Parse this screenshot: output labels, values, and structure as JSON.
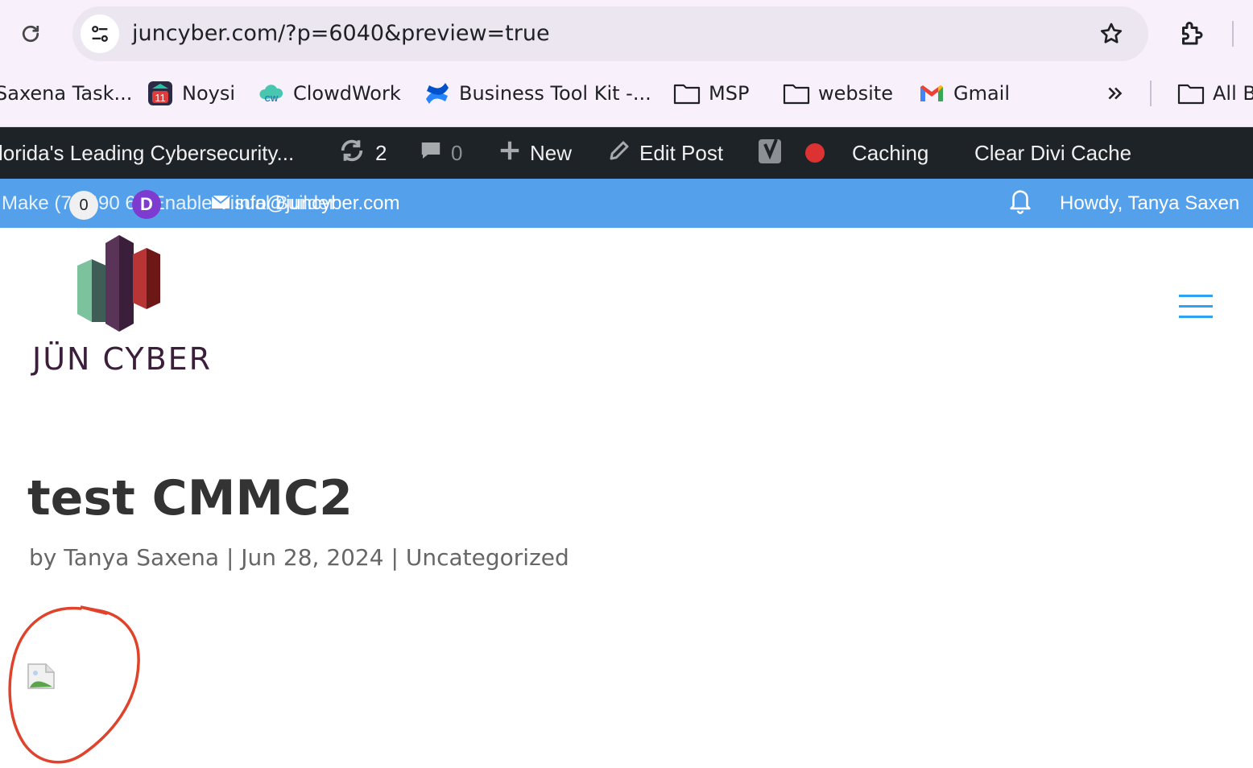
{
  "browser": {
    "url": "juncyber.com/?p=6040&preview=true",
    "bookmarks": [
      {
        "label": "Saxena Task...",
        "icon": "none"
      },
      {
        "label": "Noysi",
        "icon": "noysi-icon"
      },
      {
        "label": "ClowdWork",
        "icon": "clowdwork-icon"
      },
      {
        "label": "Business Tool Kit -...",
        "icon": "confluence-icon"
      },
      {
        "label": "MSP",
        "icon": "folder-icon"
      },
      {
        "label": "website",
        "icon": "folder-icon"
      },
      {
        "label": "Gmail",
        "icon": "gmail-icon"
      }
    ],
    "all_bookmarks_label": "All B",
    "noysi_badge": "11"
  },
  "admin_bar": {
    "site_name": "lorida's Leading Cybersecurity...",
    "updates_count": "2",
    "comments_count": "0",
    "new_label": "New",
    "edit_post_label": "Edit Post",
    "caching_label": "Caching",
    "clear_cache_label": "Clear Divi Cache"
  },
  "top_bar": {
    "overlap_text": "Make (71 490 66 Enable Visual Builder",
    "notif_count": "0",
    "email": "info@juncyber.com",
    "howdy": "Howdy, Tanya Saxen"
  },
  "header": {
    "logo_text": "JÜN CYBER"
  },
  "post": {
    "title": "test CMMC2",
    "by": "by",
    "author": "Tanya Saxena",
    "date": "Jun 28, 2024",
    "category": "Uncategorized",
    "sep": "|"
  },
  "colors": {
    "admin_bar_bg": "#1d2327",
    "top_bar_bg": "#54a0ea",
    "accent": "#2ea3f2",
    "annotation": "#e0432b"
  }
}
